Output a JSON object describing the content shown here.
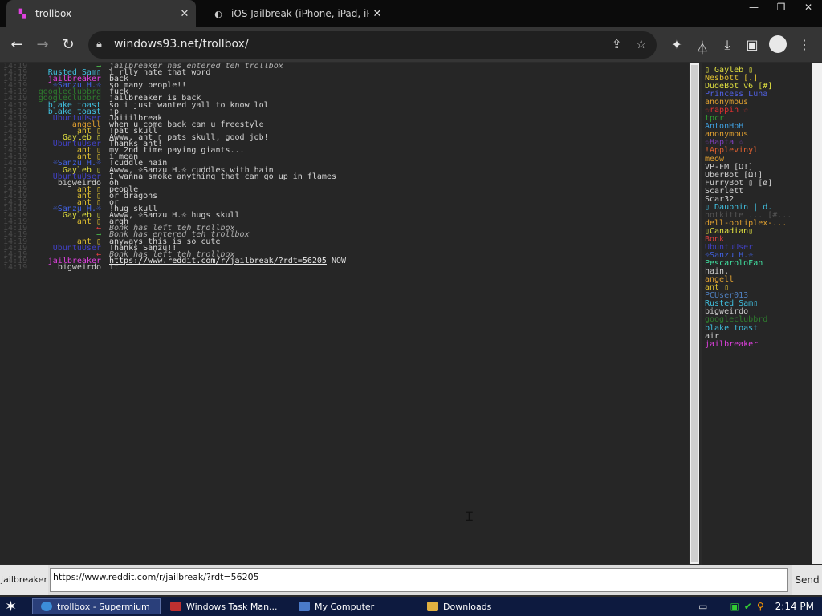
{
  "browser": {
    "tabs": [
      {
        "title": "trollbox",
        "active": true,
        "favicon": "trollbox-favicon"
      },
      {
        "title": "iOS Jailbreak (iPhone, iPad, iPod Tou",
        "active": false,
        "favicon": "reddit-favicon"
      }
    ],
    "window_controls": {
      "minimize": "—",
      "restore": "❐",
      "close": "✕"
    },
    "url": "windows93.net/trollbox/",
    "icons": [
      "back-icon",
      "forward-icon",
      "reload-icon",
      "lock-icon",
      "share-icon",
      "star-icon",
      "extensions-icon",
      "labs-icon",
      "download-icon",
      "sidepanel-icon",
      "profile-icon",
      "menu-icon"
    ]
  },
  "chat": {
    "timestamp": "14:19",
    "messages": [
      {
        "nick": "→",
        "nick_color": "#50d050",
        "text": "jailbreaker has entered teh trollbox",
        "system": true,
        "sys_nick": "jailbreaker",
        "sys_nick_color": "#e040e0"
      },
      {
        "nick": "Rusted Sam▯",
        "nick_color": "#40c0e0",
        "text": "i rlly hate that word"
      },
      {
        "nick": "jailbreaker",
        "nick_color": "#e040e0",
        "text": "back"
      },
      {
        "nick": "☼Sanzu H.☼",
        "nick_color": "#4060e0",
        "text": "so many people!!"
      },
      {
        "nick": "googleclubbrd",
        "nick_color": "#2e7d2e",
        "text": "fuck"
      },
      {
        "nick": "googleclubbrd",
        "nick_color": "#2e7d2e",
        "text": "jailbreaker is back"
      },
      {
        "nick": "blake toast",
        "nick_color": "#40c0e0",
        "text": "so i just wanted yall to know lol"
      },
      {
        "nick": "blake toast",
        "nick_color": "#40c0e0",
        "text": "jp"
      },
      {
        "nick": "UbuntuUser",
        "nick_color": "#4040c0",
        "text": "Jaiiilbreak"
      },
      {
        "nick": "angell",
        "nick_color": "#e0a030",
        "text": "when u come back can u freestyle"
      },
      {
        "nick": "ant ▯",
        "nick_color": "#e0c030",
        "text": "!pat skull"
      },
      {
        "nick": "Gayleb ▯",
        "nick_color": "#e0e040",
        "text": "Awww, ant ▯ pats skull, good job!"
      },
      {
        "nick": "UbuntuUser",
        "nick_color": "#4040c0",
        "text": "Thanks ant!"
      },
      {
        "nick": "ant ▯",
        "nick_color": "#e0c030",
        "text": "my 2nd time paying giants..."
      },
      {
        "nick": "ant ▯",
        "nick_color": "#e0c030",
        "text": "i mean"
      },
      {
        "nick": "☼Sanzu H.☼",
        "nick_color": "#4060e0",
        "text": "!cuddle hain"
      },
      {
        "nick": "Gayleb ▯",
        "nick_color": "#e0e040",
        "text": "Awww, ☼Sanzu H.☼ cuddles with hain"
      },
      {
        "nick": "UbuntuUser",
        "nick_color": "#4040c0",
        "text": "I wanna smoke anything that can go up in flames"
      },
      {
        "nick": "bigweirdo",
        "nick_color": "#d0d0d0",
        "text": "oh"
      },
      {
        "nick": "ant ▯",
        "nick_color": "#e0c030",
        "text": "people"
      },
      {
        "nick": "ant ▯",
        "nick_color": "#e0c030",
        "text": "or dragons"
      },
      {
        "nick": "ant ▯",
        "nick_color": "#e0c030",
        "text": "or"
      },
      {
        "nick": "☼Sanzu H.☼",
        "nick_color": "#4060e0",
        "text": "!hug skull"
      },
      {
        "nick": "Gayleb ▯",
        "nick_color": "#e0e040",
        "text": "Awww, ☼Sanzu H.☼ hugs skull"
      },
      {
        "nick": "ant ▯",
        "nick_color": "#e0c030",
        "text": "argh"
      },
      {
        "nick": "←",
        "nick_color": "#e04040",
        "text": "Bonk has left teh trollbox",
        "system": true,
        "sys_nick": "Bonk",
        "sys_nick_color": "#e04040"
      },
      {
        "nick": "→",
        "nick_color": "#50d050",
        "text": "Bonk has entered teh trollbox",
        "system": true,
        "sys_nick": "Bonk",
        "sys_nick_color": "#e04040"
      },
      {
        "nick": "ant ▯",
        "nick_color": "#e0c030",
        "text": "anyways this is so cute"
      },
      {
        "nick": "UbuntuUser",
        "nick_color": "#4040c0",
        "text": "Thanks Sanzu!!"
      },
      {
        "nick": "←",
        "nick_color": "#e04040",
        "text": "Bonk has left teh trollbox",
        "system": true,
        "sys_nick": "Bonk",
        "sys_nick_color": "#e04040"
      },
      {
        "nick": "jailbreaker",
        "nick_color": "#e040e0",
        "text": "https://www.reddit.com/r/jailbreak/?rdt=56205",
        "link": true,
        "suffix": " NOW"
      },
      {
        "nick": "bigweirdo",
        "nick_color": "#d0d0d0",
        "text": "it"
      }
    ]
  },
  "users": [
    {
      "name": "▯ Gayleb ▯",
      "color": "#e0e040"
    },
    {
      "name": "Nesbott [.]",
      "color": "#e0c030"
    },
    {
      "name": "DudeBot v6 [#]",
      "color": "#e0e040"
    },
    {
      "name": "Princess Luna",
      "color": "#5060e0"
    },
    {
      "name": "anonymous",
      "color": "#e0a030"
    },
    {
      "name": "☆rappin ☆",
      "color": "#e03030"
    },
    {
      "name": "tpcr",
      "color": "#30a030"
    },
    {
      "name": "AntonHbH",
      "color": "#40a0e0"
    },
    {
      "name": "anonymous",
      "color": "#e0a030"
    },
    {
      "name": "☆Hapta ☆",
      "color": "#8040c0"
    },
    {
      "name": "!Applevinyl",
      "color": "#e06030"
    },
    {
      "name": "meow",
      "color": "#e0a030"
    },
    {
      "name": "VP-FM [Ω!]",
      "color": "#d0d0d0"
    },
    {
      "name": "UberBot [Ω!]",
      "color": "#d0d0d0"
    },
    {
      "name": "FurryBot ▯ [ø]",
      "color": "#d0d0d0"
    },
    {
      "name": "Scarlett",
      "color": "#d0d0d0"
    },
    {
      "name": "Scar32",
      "color": "#d0d0d0"
    },
    {
      "name": "▯ Dauphin | d.",
      "color": "#40c0e0"
    },
    {
      "name": "hotkitte ... [#...",
      "color": "#555555"
    },
    {
      "name": "dell-optiplex-...",
      "color": "#e0a030"
    },
    {
      "name": "▯Canadian▯",
      "color": "#e0e040"
    },
    {
      "name": "Bonk",
      "color": "#e04040"
    },
    {
      "name": "UbuntuUser",
      "color": "#4040c0"
    },
    {
      "name": "☼Sanzu H.☼",
      "color": "#4060e0"
    },
    {
      "name": "PescaroloFan",
      "color": "#40e0a0"
    },
    {
      "name": "hain.",
      "color": "#d0d0d0"
    },
    {
      "name": "angell",
      "color": "#e0a030"
    },
    {
      "name": "ant ▯",
      "color": "#e0c030"
    },
    {
      "name": "PCUser013",
      "color": "#5080c0"
    },
    {
      "name": "Rusted Sam▯",
      "color": "#40c0e0"
    },
    {
      "name": "bigweirdo",
      "color": "#d0d0d0"
    },
    {
      "name": "googleclubbrd",
      "color": "#2e7d2e"
    },
    {
      "name": "blake toast",
      "color": "#40c0e0"
    },
    {
      "name": "air",
      "color": "#d0d0d0"
    },
    {
      "name": "jailbreaker",
      "color": "#e040e0"
    }
  ],
  "input": {
    "nick": "jailbreaker",
    "value": "https://www.reddit.com/r/jailbreak/?rdt=56205",
    "send_label": "Send"
  },
  "taskbar": {
    "tasks": [
      {
        "label": "trollbox - Supermium",
        "active": true,
        "icon_color": "#3c8dd8"
      },
      {
        "label": "Windows Task Man...",
        "active": false,
        "icon_color": "#c03030"
      },
      {
        "label": "My Computer",
        "active": false,
        "icon_color": "#4a7ac8"
      },
      {
        "label": "Downloads",
        "active": false,
        "icon_color": "#e0b040"
      }
    ],
    "clock": "2:14 PM"
  }
}
